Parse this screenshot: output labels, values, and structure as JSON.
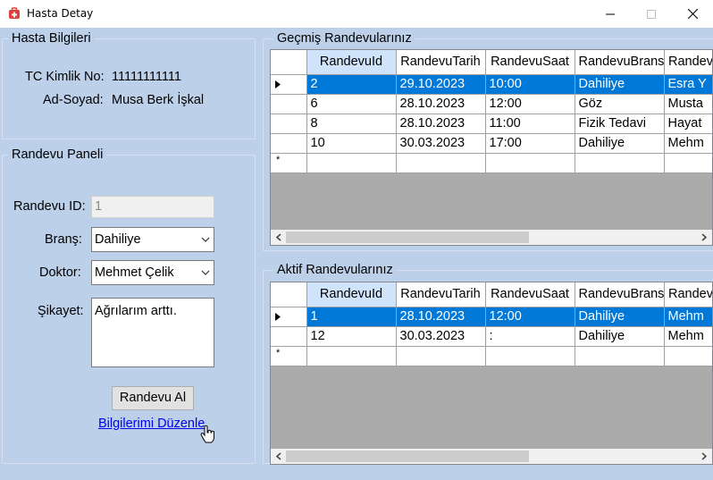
{
  "window": {
    "title": "Hasta Detay"
  },
  "patient_info": {
    "title": "Hasta Bilgileri",
    "tc_label": "TC Kimlik No:",
    "tc_value": "11111111111",
    "name_label": "Ad-Soyad:",
    "name_value": "Musa Berk İşkal"
  },
  "appointment_panel": {
    "title": "Randevu Paneli",
    "id_label": "Randevu ID:",
    "id_value": "1",
    "branch_label": "Branş:",
    "branch_value": "Dahiliye",
    "doctor_label": "Doktor:",
    "doctor_value": "Mehmet Çelik",
    "complaint_label": "Şikayet:",
    "complaint_value": "Ağrılarım arttı.",
    "book_button": "Randevu Al",
    "edit_link": "Bilgilerimi Düzenle"
  },
  "past_appointments": {
    "title": "Geçmiş Randevularınız",
    "columns": [
      "RandevuId",
      "RandevuTarih",
      "RandevuSaat",
      "RandevuBrans",
      "Randev"
    ],
    "rows": [
      [
        "2",
        "29.10.2023",
        "10:00",
        "Dahiliye",
        "Esra Y"
      ],
      [
        "6",
        "28.10.2023",
        "12:00",
        "Göz",
        "Musta"
      ],
      [
        "8",
        "28.10.2023",
        "11:00",
        "Fizik Tedavi",
        "Hayat"
      ],
      [
        "10",
        "30.03.2023",
        "17:00",
        "Dahiliye",
        "Mehm"
      ]
    ],
    "new_row_marker": "*"
  },
  "active_appointments": {
    "title": "Aktif Randevularınız",
    "columns": [
      "RandevuId",
      "RandevuTarih",
      "RandevuSaat",
      "RandevuBrans",
      "Randev"
    ],
    "rows": [
      [
        "1",
        "28.10.2023",
        "12:00",
        "Dahiliye",
        "Mehm"
      ],
      [
        "12",
        "30.03.2023",
        " :",
        "Dahiliye",
        "Mehm"
      ]
    ],
    "new_row_marker": "*"
  },
  "colors": {
    "client_bg": "#bdd0e9",
    "selection": "#0078d7",
    "sorted_header": "#cfe3fb",
    "link": "#0000ee",
    "app_icon": "#e0413c"
  }
}
